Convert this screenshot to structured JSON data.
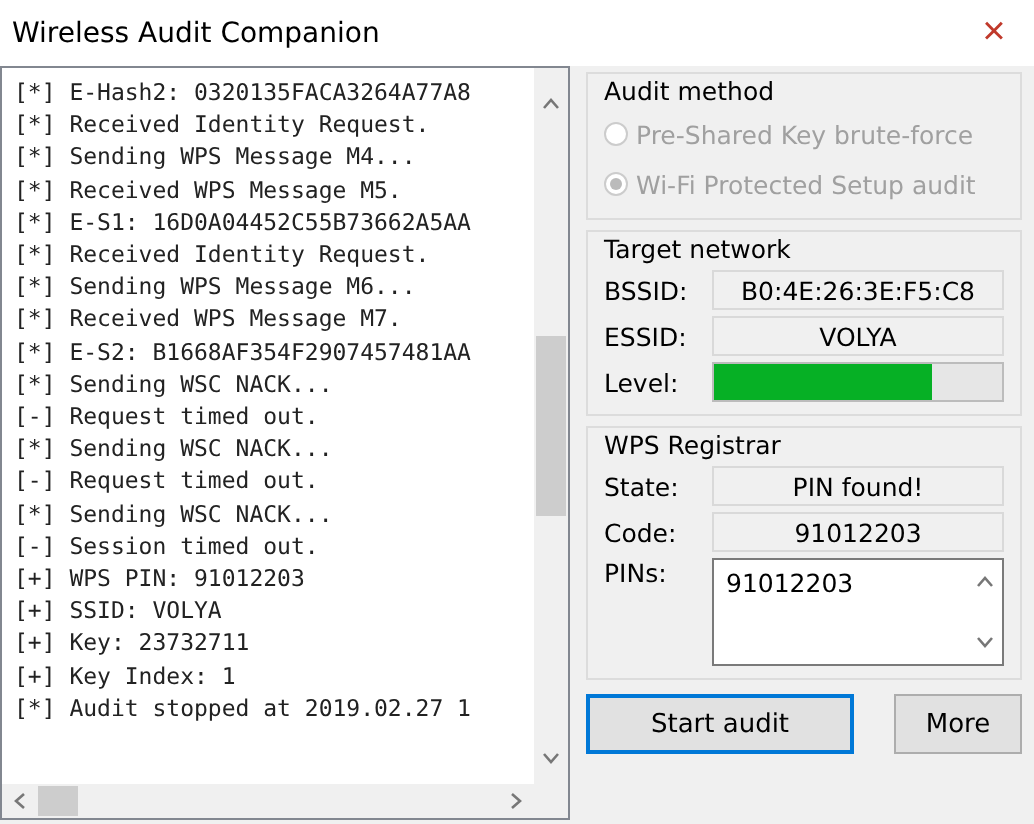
{
  "window": {
    "title": "Wireless Audit Companion",
    "close": "×"
  },
  "log": {
    "lines": [
      "[*] E-Hash2: 0320135FACA3264A77A8",
      "[*] Received Identity Request.",
      "[*] Sending WPS Message M4...",
      "[*] Received WPS Message M5.",
      "[*] E-S1: 16D0A04452C55B73662A5AA",
      "[*] Received Identity Request.",
      "[*] Sending WPS Message M6...",
      "[*] Received WPS Message M7.",
      "[*] E-S2: B1668AF354F2907457481AA",
      "[*] Sending WSC NACK...",
      "[-] Request timed out.",
      "[*] Sending WSC NACK...",
      "[-] Request timed out.",
      "[*] Sending WSC NACK...",
      "[-] Session timed out.",
      "[+] WPS PIN: 91012203",
      "[+] SSID: VOLYA",
      "[+] Key: 23732711",
      "[+] Key Index: 1",
      "[*] Audit stopped at 2019.02.27 1"
    ]
  },
  "audit_method": {
    "title": "Audit method",
    "options": [
      {
        "label": "Pre-Shared Key brute-force",
        "selected": false,
        "disabled": true
      },
      {
        "label": "Wi-Fi Protected Setup audit",
        "selected": true,
        "disabled": true
      }
    ]
  },
  "target_network": {
    "title": "Target network",
    "bssid_label": "BSSID:",
    "bssid": "B0:4E:26:3E:F5:C8",
    "essid_label": "ESSID:",
    "essid": "VOLYA",
    "level_label": "Level:",
    "level": 0.76
  },
  "wps_registrar": {
    "title": "WPS Registrar",
    "state_label": "State:",
    "state": "PIN found!",
    "code_label": "Code:",
    "code": "91012203",
    "pins_label": "PINs:",
    "pins": "91012203"
  },
  "buttons": [
    {
      "label": "Start audit",
      "focused": true
    },
    {
      "label": "More",
      "focused": false
    }
  ]
}
